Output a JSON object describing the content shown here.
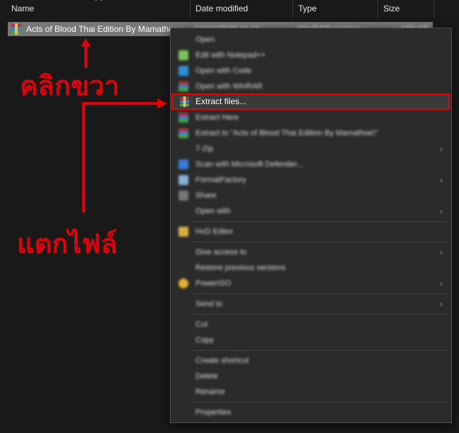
{
  "columns": {
    "name": "Name",
    "date_modified": "Date modified",
    "type": "Type",
    "size": "Size"
  },
  "file": {
    "name": "Acts of Blood Thai Edition By Mamathoe...",
    "date_modified": "13/10/2568 11:11",
    "type": "WinRAR archive",
    "size": "189 KB",
    "icon": "winrar-archive-icon"
  },
  "menu": {
    "items": [
      {
        "label": "Open",
        "icon": ""
      },
      {
        "label": "Edit with Notepad++",
        "icon": "notepadpp-icon"
      },
      {
        "label": "Open with Code",
        "icon": "vscode-icon"
      },
      {
        "label": "Open with WinRAR",
        "icon": "winrar-icon"
      },
      {
        "label": "Extract files...",
        "icon": "winrar-icon"
      },
      {
        "label": "Extract Here",
        "icon": "winrar-icon"
      },
      {
        "label": "Extract to \"Acts of Blood Thai Edition By Mamathoe\\\"",
        "icon": "winrar-icon"
      },
      {
        "label": "7-Zip",
        "icon": ""
      },
      {
        "label": "Scan with Microsoft Defender...",
        "icon": "defender-icon"
      },
      {
        "label": "FormatFactory",
        "icon": "formatfactory-icon"
      },
      {
        "label": "Share",
        "icon": "share-icon"
      },
      {
        "label": "Open with",
        "icon": ""
      },
      {
        "label": "HxD Editor",
        "icon": "hxd-icon"
      },
      {
        "label": "Give access to",
        "icon": ""
      },
      {
        "label": "Restore previous versions",
        "icon": ""
      },
      {
        "label": "PowerISO",
        "icon": "poweriso-icon"
      },
      {
        "label": "Send to",
        "icon": ""
      },
      {
        "label": "Cut",
        "icon": ""
      },
      {
        "label": "Copy",
        "icon": ""
      },
      {
        "label": "Create shortcut",
        "icon": ""
      },
      {
        "label": "Delete",
        "icon": ""
      },
      {
        "label": "Rename",
        "icon": ""
      },
      {
        "label": "Properties",
        "icon": ""
      }
    ]
  },
  "annotations": {
    "right_click": "คลิกขวา",
    "extract": "แตกไฟล์"
  },
  "colors": {
    "annotation_red": "#e0000a",
    "background": "#191919",
    "menu_bg": "#2b2b2b",
    "selected_row": "#777777"
  }
}
